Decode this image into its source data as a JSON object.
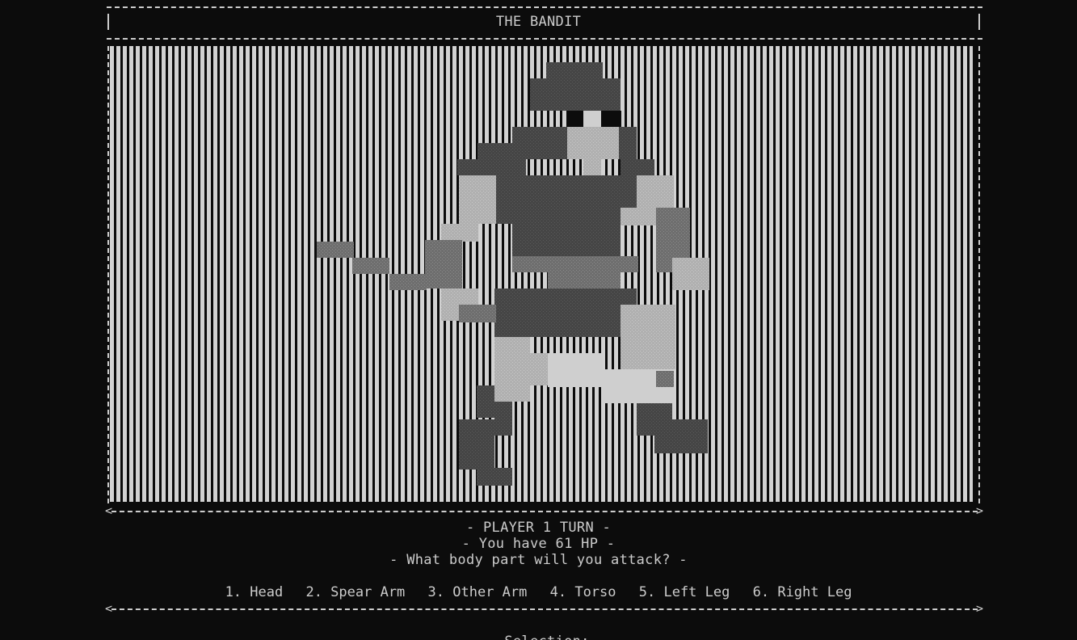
{
  "header": {
    "title": "THE BANDIT"
  },
  "enemy": {
    "name": "bandit",
    "sprite": "bandit-sprite"
  },
  "status": {
    "turn": "- PLAYER 1 TURN -",
    "hp": "- You have 61 HP -",
    "prompt": "- What body part will you attack? -"
  },
  "options": [
    {
      "label": "1. Head"
    },
    {
      "label": "2. Spear Arm"
    },
    {
      "label": "3. Other Arm"
    },
    {
      "label": "4. Torso"
    },
    {
      "label": "5. Left Leg"
    },
    {
      "label": "6. Right Leg"
    }
  ],
  "input": {
    "prompt": "Selection:",
    "value": ""
  },
  "colors": {
    "background": "#0c0c0c",
    "text": "#cccccc",
    "stripe_light": "#d2d2d2",
    "sprite_dark": "#474747",
    "sprite_mid": "#777777",
    "sprite_light": "#b4b4b4",
    "sprite_white": "#cfcfcf",
    "sprite_black": "#0c0c0c"
  }
}
